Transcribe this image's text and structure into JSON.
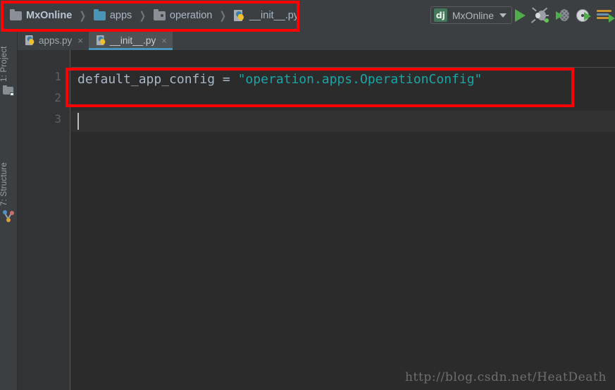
{
  "window": {
    "theme_background": "#2b2b2b",
    "panel_background": "#3c3f41",
    "accent": "#4a95b5"
  },
  "breadcrumb": {
    "name": "navigation-breadcrumb",
    "separator": "❯",
    "items": [
      {
        "label": "MxOnline",
        "icon": "folder-module-icon"
      },
      {
        "label": "apps",
        "icon": "folder-blue-icon"
      },
      {
        "label": "operation",
        "icon": "folder-source-root-icon"
      },
      {
        "label": "__init__.py",
        "icon": "python-file-icon"
      }
    ]
  },
  "toolbar": {
    "run_configuration": {
      "badge_text": "dj",
      "name": "MxOnline",
      "badge_color": "#44785a",
      "status_dot_color": "#62c554"
    },
    "buttons": [
      {
        "name": "run-button",
        "icon": "run-triangle-icon"
      },
      {
        "name": "debug-button",
        "icon": "debug-bug-icon"
      },
      {
        "name": "run-with-coverage-button",
        "icon": "coverage-icon"
      },
      {
        "name": "profile-button",
        "icon": "profile-icon"
      },
      {
        "name": "attach-to-process-button",
        "icon": "attach-process-icon"
      }
    ]
  },
  "tool_windows": {
    "project": {
      "label": "1: Project",
      "icon": "project-folder-icon"
    },
    "structure": {
      "label": "7: Structure",
      "icon": "structure-nodes-icon"
    }
  },
  "editor_tabs": [
    {
      "label": "apps.py",
      "active": false,
      "icon": "python-file-icon",
      "close": "×"
    },
    {
      "label": "__init__.py",
      "active": true,
      "icon": "python-file-icon",
      "close": "×"
    }
  ],
  "editor": {
    "line_numbers": [
      "1",
      "2",
      "3"
    ],
    "lines": [
      {
        "number": "1",
        "tokens": [
          {
            "text": "default_app_config",
            "type": "plain"
          },
          {
            "text": " = ",
            "type": "operator"
          },
          {
            "text": "\"operation.apps.OperationConfig\"",
            "type": "string"
          }
        ]
      },
      {
        "number": "2",
        "tokens": []
      },
      {
        "number": "3",
        "tokens": [],
        "caret": true
      }
    ],
    "string_color": "#1aa5a5",
    "text_color": "#a9b7c6"
  },
  "watermark": {
    "text": "http://blog.csdn.net/HeatDeath"
  },
  "annotations": [
    {
      "name": "breadcrumb-highlight",
      "color": "#fe0000"
    },
    {
      "name": "code-line-highlight",
      "color": "#fe0000"
    }
  ]
}
